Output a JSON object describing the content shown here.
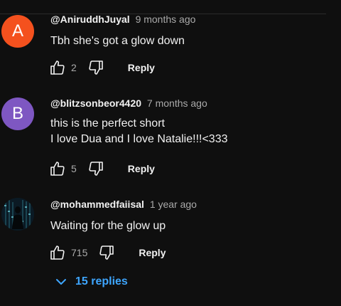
{
  "comments": [
    {
      "avatar_letter": "A",
      "avatar_color": "#f4511e",
      "author": "@AniruddhJuyal",
      "time": "9 months ago",
      "text_lines": [
        "Tbh she's got a glow down"
      ],
      "likes": "2",
      "reply_label": "Reply"
    },
    {
      "avatar_letter": "B",
      "avatar_color": "#7e57c2",
      "author": "@blitzsonbeor4420",
      "time": "7 months ago",
      "text_lines": [
        "this is the perfect short",
        "I love Dua and I love Natalie!!!<333"
      ],
      "likes": "5",
      "reply_label": "Reply"
    },
    {
      "avatar_letter": "",
      "avatar_color": "#0b1a24",
      "author": "@mohammedfaiisal",
      "time": "1 year ago",
      "text_lines": [
        "Waiting for the glow up"
      ],
      "likes": "715",
      "reply_label": "Reply"
    }
  ],
  "replies_toggle": {
    "label": "15 replies",
    "color": "#3ea6ff"
  },
  "icons": {
    "like": "thumbs-up-icon",
    "dislike": "thumbs-down-icon",
    "expand": "chevron-down-icon"
  }
}
